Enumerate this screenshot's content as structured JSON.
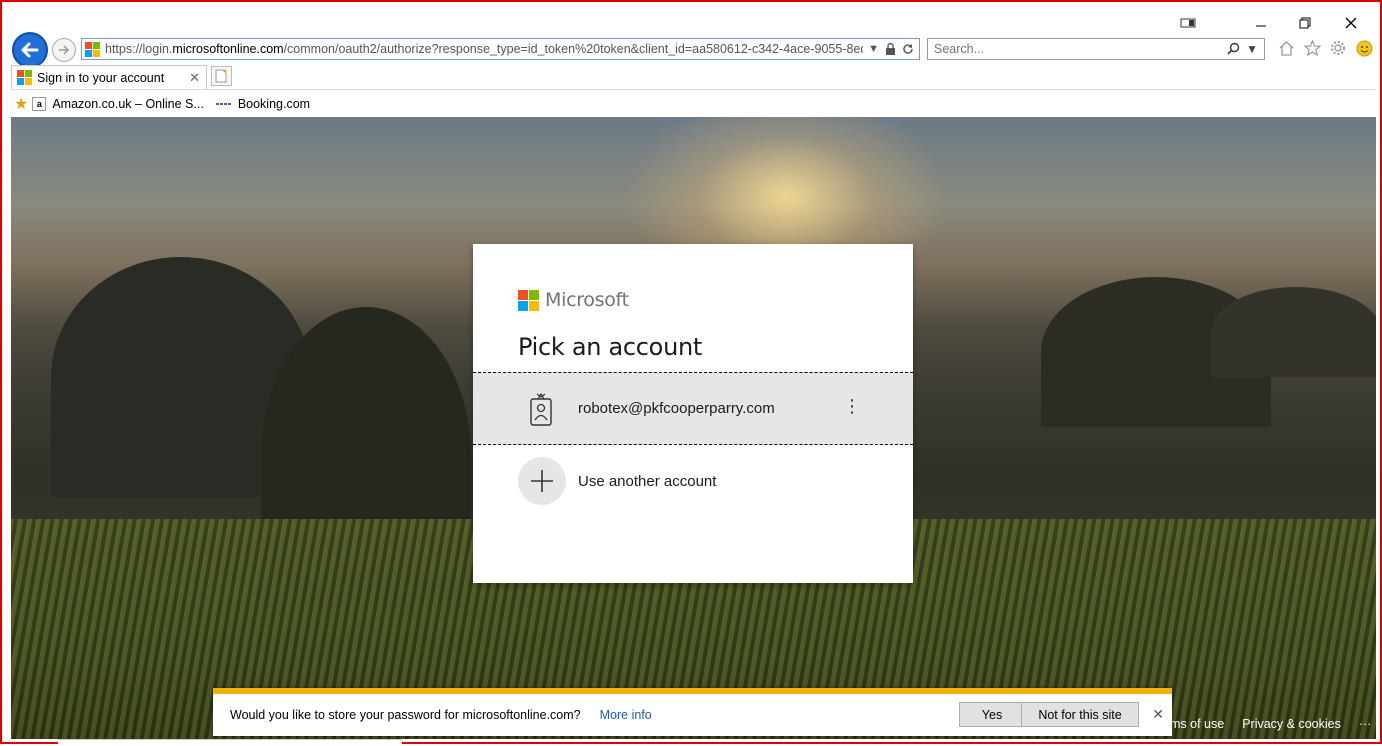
{
  "browser": {
    "address_url_prefix": "https://login.",
    "address_url_domain": "microsoftonline.com",
    "address_url_rest": "/common/oauth2/authorize?response_type=id_token%20token&client_id=aa580612-c342-4ace-9055-8edee43",
    "search_placeholder": "Search...",
    "tab_title": "Sign in to your account",
    "favorites": [
      {
        "label": "Amazon.co.uk – Online S..."
      },
      {
        "label": "Booking.com"
      }
    ]
  },
  "dialog": {
    "brand": "Microsoft",
    "title": "Pick an account",
    "account_email": "robotex@pkfcooperparry.com",
    "another_label": "Use another account"
  },
  "footer": {
    "terms_label": "ms of use",
    "privacy_label": "Privacy & cookies",
    "more_label": "···"
  },
  "notification": {
    "message": "Would you like to store your password for microsoftonline.com?",
    "more_info": "More info",
    "yes_label": "Yes",
    "no_label": "Not for this site"
  },
  "colors": {
    "ms_red": "#f25022",
    "ms_green": "#7fba00",
    "ms_blue": "#00a4ef",
    "ms_yellow": "#ffb900",
    "notification_accent": "#f0b400"
  }
}
